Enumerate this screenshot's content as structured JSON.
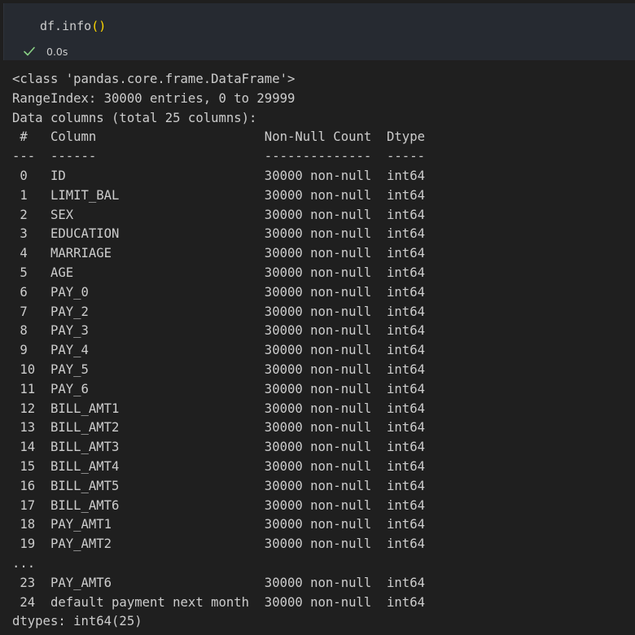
{
  "cell": {
    "code_prefix": "df.info",
    "code_paren": "()",
    "status_icon": "check-icon",
    "exec_time": "0.0s",
    "check_color": "#89d185",
    "paren_color": "#ffd700"
  },
  "output": {
    "lines": [
      "<class 'pandas.core.frame.DataFrame'>",
      "RangeIndex: 30000 entries, 0 to 29999",
      "Data columns (total 25 columns):",
      " #   Column                      Non-Null Count  Dtype",
      "---  ------                      --------------  -----",
      " 0   ID                          30000 non-null  int64",
      " 1   LIMIT_BAL                   30000 non-null  int64",
      " 2   SEX                         30000 non-null  int64",
      " 3   EDUCATION                   30000 non-null  int64",
      " 4   MARRIAGE                    30000 non-null  int64",
      " 5   AGE                         30000 non-null  int64",
      " 6   PAY_0                       30000 non-null  int64",
      " 7   PAY_2                       30000 non-null  int64",
      " 8   PAY_3                       30000 non-null  int64",
      " 9   PAY_4                       30000 non-null  int64",
      " 10  PAY_5                       30000 non-null  int64",
      " 11  PAY_6                       30000 non-null  int64",
      " 12  BILL_AMT1                   30000 non-null  int64",
      " 13  BILL_AMT2                   30000 non-null  int64",
      " 14  BILL_AMT3                   30000 non-null  int64",
      " 15  BILL_AMT4                   30000 non-null  int64",
      " 16  BILL_AMT5                   30000 non-null  int64",
      " 17  BILL_AMT6                   30000 non-null  int64",
      " 18  PAY_AMT1                    30000 non-null  int64",
      " 19  PAY_AMT2                    30000 non-null  int64",
      "...",
      " 23  PAY_AMT6                    30000 non-null  int64",
      " 24  default payment next month  30000 non-null  int64",
      "dtypes: int64(25)"
    ]
  }
}
